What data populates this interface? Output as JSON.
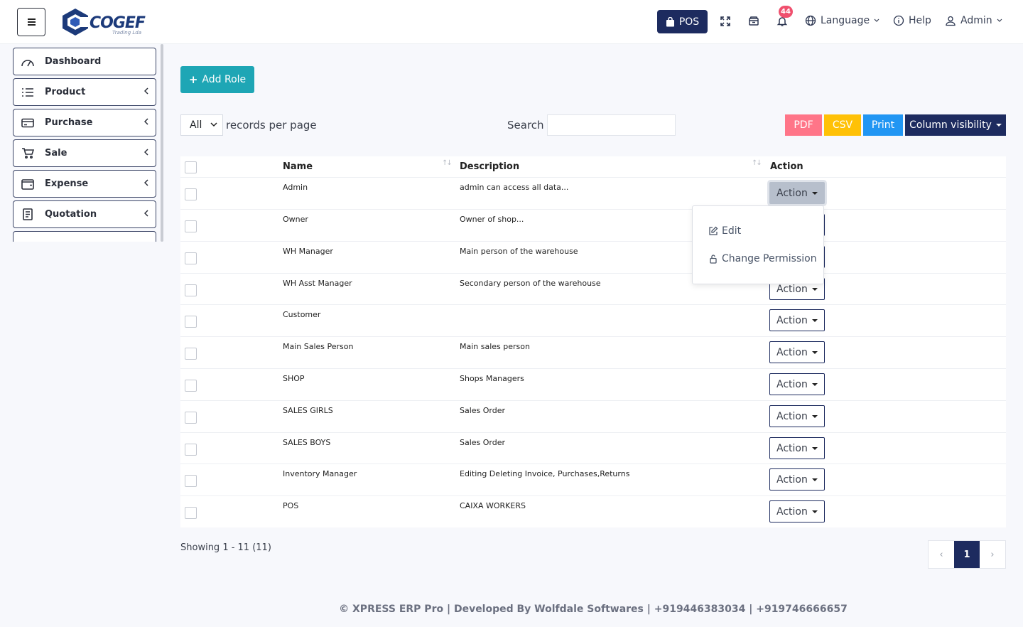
{
  "header": {
    "logo_text": "COGEF",
    "logo_sub": "Trading Lda",
    "pos_label": "POS",
    "notification_count": "44",
    "language_label": "Language",
    "help_label": "Help",
    "user_label": "Admin"
  },
  "sidebar": {
    "items": [
      {
        "label": "Dashboard",
        "icon": "gauge-icon"
      },
      {
        "label": "Product",
        "icon": "list-icon"
      },
      {
        "label": "Purchase",
        "icon": "credit-card-icon"
      },
      {
        "label": "Sale",
        "icon": "cart-icon"
      },
      {
        "label": "Expense",
        "icon": "wallet-icon"
      },
      {
        "label": "Quotation",
        "icon": "document-icon"
      }
    ]
  },
  "toolbar": {
    "add_role_label": "Add Role",
    "per_page_value": "All",
    "per_page_label": "records per page",
    "search_label": "Search",
    "search_placeholder": "",
    "pdf_label": "PDF",
    "csv_label": "CSV",
    "print_label": "Print",
    "colvis_label": "Column visibility"
  },
  "colors": {
    "primary": "#1d2b5f",
    "add_role": "#1ea6b5",
    "pdf": "#ff7588",
    "csv": "#ffc107",
    "print": "#2196f3"
  },
  "table": {
    "headers": {
      "name": "Name",
      "description": "Description",
      "action": "Action"
    },
    "action_label": "Action",
    "rows": [
      {
        "name": "Admin",
        "description": "admin can access all data..."
      },
      {
        "name": "Owner",
        "description": "Owner of shop..."
      },
      {
        "name": "WH Manager",
        "description": "Main person of the warehouse"
      },
      {
        "name": "WH Asst Manager",
        "description": "Secondary person of the warehouse"
      },
      {
        "name": "Customer",
        "description": ""
      },
      {
        "name": "Main Sales Person",
        "description": "Main sales person"
      },
      {
        "name": "SHOP",
        "description": "Shops Managers"
      },
      {
        "name": "SALES GIRLS",
        "description": "Sales Order"
      },
      {
        "name": "SALES BOYS",
        "description": "Sales Order"
      },
      {
        "name": "Inventory Manager",
        "description": "Editing Deleting Invoice, Purchases,Returns"
      },
      {
        "name": "POS",
        "description": "CAIXA WORKERS"
      }
    ]
  },
  "dropdown": {
    "edit_label": "Edit",
    "permission_label": "Change Permission"
  },
  "pagination": {
    "showing": "Showing 1 - 11 (11)",
    "current_page": "1",
    "prev": "‹",
    "next": "›"
  },
  "footer": {
    "text": "© XPRESS ERP Pro | Developed By Wolfdale Softwares | +919446383034 | +919746666657"
  }
}
